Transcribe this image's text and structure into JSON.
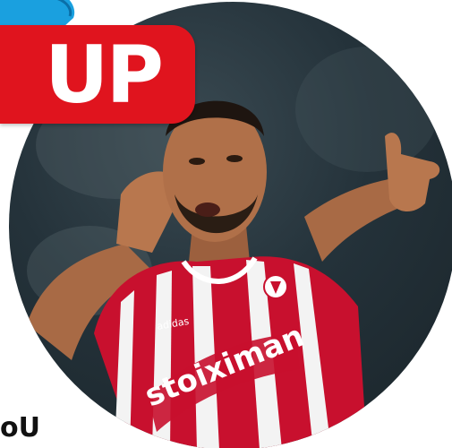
{
  "badge": {
    "label": "UP",
    "color": "#e0141e",
    "accent_color": "#1aa0df"
  },
  "photo": {
    "subject": "football player in red and white striped kit pointing forward",
    "jersey_sponsor": "stoiximan",
    "kit_brand": "adidas",
    "jersey_colors": [
      "#c8102e",
      "#ffffff"
    ]
  },
  "footer": {
    "partial_text": "οU"
  }
}
